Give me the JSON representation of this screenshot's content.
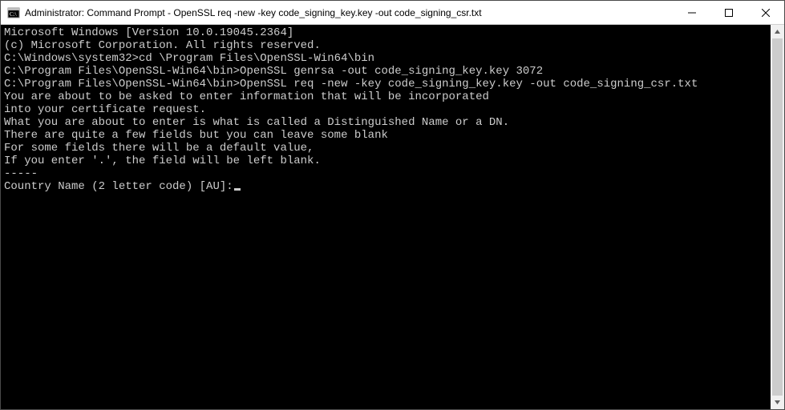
{
  "window": {
    "title": "Administrator: Command Prompt - OpenSSL  req -new -key code_signing_key.key -out code_signing_csr.txt"
  },
  "terminal": {
    "lines": [
      "Microsoft Windows [Version 10.0.19045.2364]",
      "(c) Microsoft Corporation. All rights reserved.",
      "",
      "C:\\Windows\\system32>cd \\Program Files\\OpenSSL-Win64\\bin",
      "",
      "C:\\Program Files\\OpenSSL-Win64\\bin>OpenSSL genrsa -out code_signing_key.key 3072",
      "",
      "C:\\Program Files\\OpenSSL-Win64\\bin>OpenSSL req -new -key code_signing_key.key -out code_signing_csr.txt",
      "You are about to be asked to enter information that will be incorporated",
      "into your certificate request.",
      "What you are about to enter is what is called a Distinguished Name or a DN.",
      "There are quite a few fields but you can leave some blank",
      "For some fields there will be a default value,",
      "If you enter '.', the field will be left blank.",
      "-----",
      "Country Name (2 letter code) [AU]:"
    ]
  },
  "colors": {
    "bg": "#000000",
    "fg": "#cccccc",
    "titlebar_bg": "#ffffff"
  }
}
